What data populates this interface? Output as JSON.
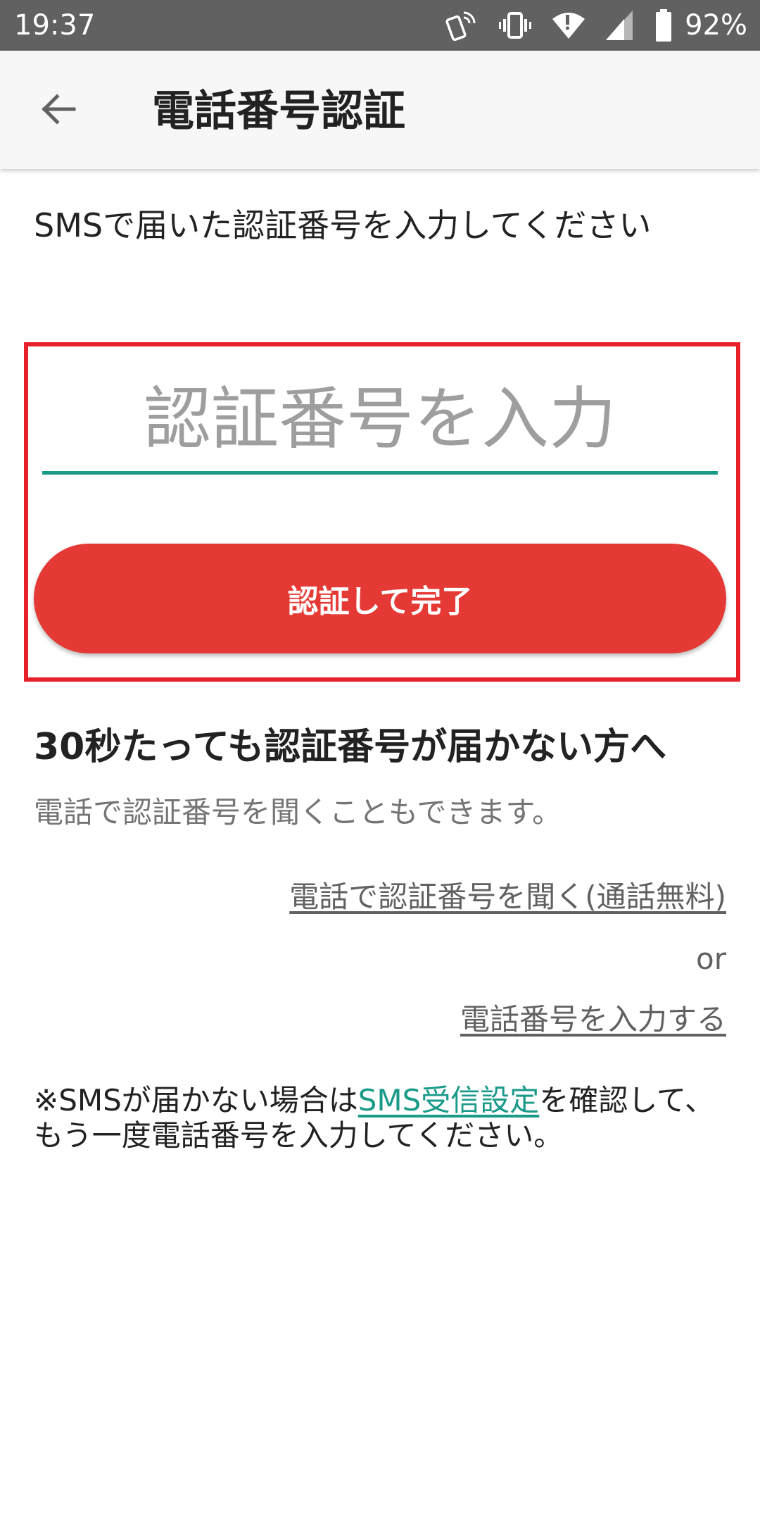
{
  "status_bar": {
    "time": "19:37",
    "battery": "92%",
    "icons": [
      "nfc-phone-icon",
      "vibrate-icon",
      "wifi-icon",
      "cellular-signal-icon",
      "battery-icon"
    ]
  },
  "app_bar": {
    "back_icon": "arrow-back-icon",
    "title": "電話番号認証"
  },
  "main": {
    "instruction": "SMSで届いた認証番号を入力してください",
    "code_input": {
      "value": "",
      "placeholder": "認証番号を入力"
    },
    "verify_button_label": "認証して完了",
    "help": {
      "heading": "30秒たっても認証番号が届かない方へ",
      "subtext": "電話で認証番号を聞くこともできます。",
      "call_link": "電話で認証番号を聞く(通話無料)",
      "or_text": "or",
      "reenter_link": "電話番号を入力する"
    },
    "note": {
      "prefix": "※SMSが届かない場合は",
      "link": "SMS受信設定",
      "suffix": "を確認して、もう一度電話番号を入力してください。"
    }
  },
  "colors": {
    "status_bar": "#616161",
    "app_bar": "#f7f7f7",
    "accent_teal": "#1a9a89",
    "button_red": "#e53935",
    "highlight_red": "#e8202a"
  }
}
